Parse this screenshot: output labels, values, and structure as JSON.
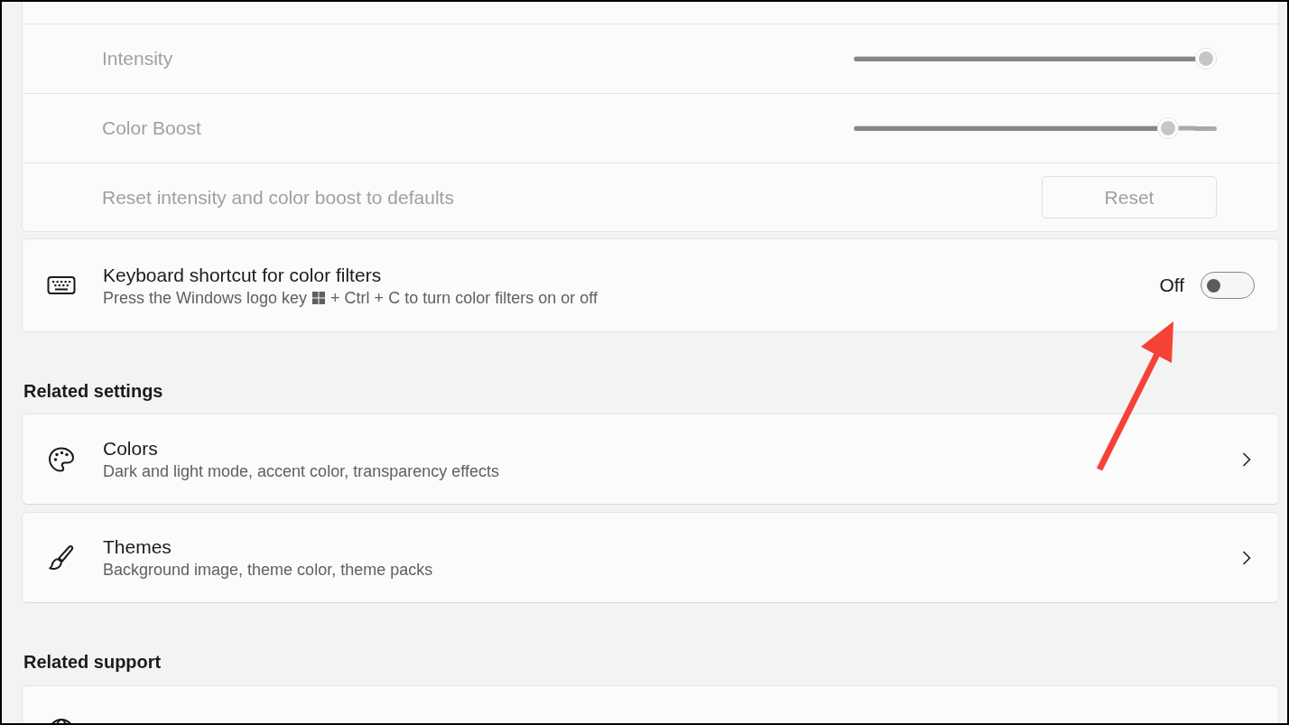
{
  "color_filter_adjustments": {
    "disabled": true,
    "rows": [
      {
        "kind": "slider",
        "label": "Intensity",
        "level": 1
      },
      {
        "kind": "slider",
        "label": "Color Boost",
        "level": 0.89
      },
      {
        "kind": "button",
        "label": "Reset intensity and color boost to defaults",
        "button": "Reset"
      }
    ]
  },
  "keyboard_shortcut": {
    "title": "Keyboard shortcut for color filters",
    "description_parts": [
      {
        "kind": "text",
        "text": "Press the Windows logo key"
      },
      {
        "kind": "windows-key"
      },
      {
        "kind": "text",
        "text": "+ Ctrl + C to turn color filters on or off"
      }
    ],
    "state_label": "Off",
    "on": false
  },
  "related_settings": {
    "heading": "Related settings",
    "items": [
      {
        "title": "Colors",
        "description": "Dark and light mode, accent color, transparency effects"
      },
      {
        "title": "Themes",
        "description": "Background image, theme color, theme packs"
      }
    ]
  },
  "related_support": {
    "heading": "Related support"
  }
}
